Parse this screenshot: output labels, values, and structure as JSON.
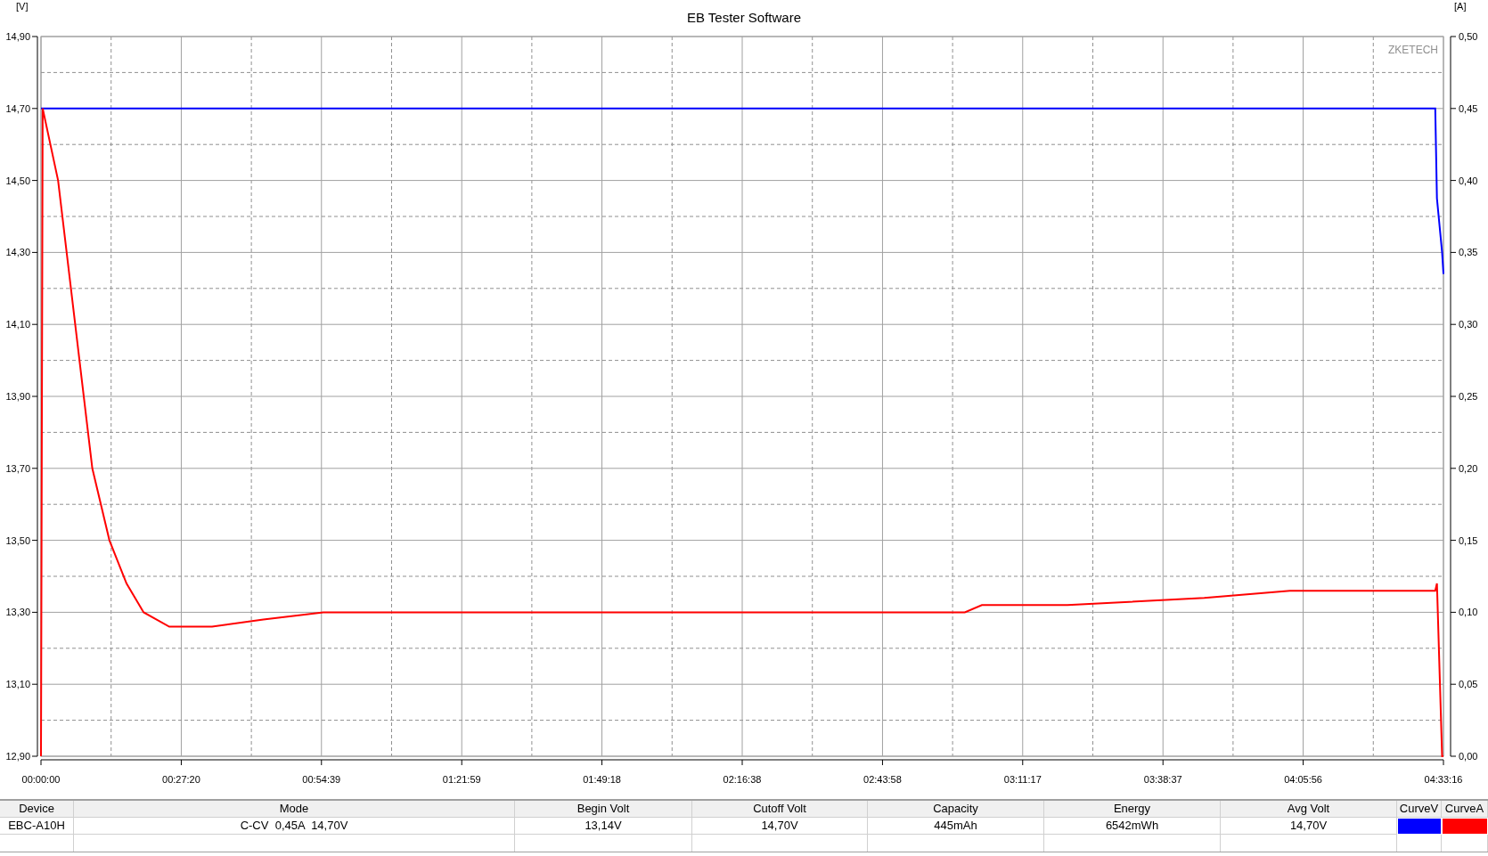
{
  "chart": {
    "brand_label": "ZKETECH",
    "chart_data": {
      "type": "line",
      "title": "EB Tester Software",
      "ylabel": "[V]",
      "grid": true,
      "x": [
        0,
        20,
        200,
        400,
        600,
        800,
        1000,
        1200,
        1500,
        2000,
        2600,
        3300,
        5000,
        8000,
        10800,
        11000,
        12000,
        13600,
        14600,
        16300,
        16320,
        16380,
        16396
      ],
      "series": [
        {
          "name": "CurveV",
          "color": "#0000ff",
          "values": [
            14.7,
            14.7,
            14.7,
            14.7,
            14.7,
            14.7,
            14.7,
            14.7,
            14.7,
            14.7,
            14.7,
            14.7,
            14.7,
            14.7,
            14.7,
            14.7,
            14.7,
            14.7,
            14.7,
            14.7,
            14.45,
            14.3,
            14.24
          ]
        }
      ],
      "xlim": [
        0,
        16396
      ],
      "ylim": [
        12.9,
        14.9
      ],
      "xticks": [
        {
          "value": 0,
          "label": "00:00:00"
        },
        {
          "value": 1640,
          "label": "00:27:20"
        },
        {
          "value": 3279,
          "label": "00:54:39"
        },
        {
          "value": 4919,
          "label": "01:21:59"
        },
        {
          "value": 6558,
          "label": "01:49:18"
        },
        {
          "value": 8198,
          "label": "02:16:38"
        },
        {
          "value": 9838,
          "label": "02:43:58"
        },
        {
          "value": 11477,
          "label": "03:11:17"
        },
        {
          "value": 13117,
          "label": "03:38:37"
        },
        {
          "value": 14756,
          "label": "04:05:56"
        },
        {
          "value": 16396,
          "label": "04:33:16"
        }
      ],
      "yticks": [
        {
          "value": 12.9,
          "label": "12,90"
        },
        {
          "value": 13.1,
          "label": "13,10"
        },
        {
          "value": 13.3,
          "label": "13,30"
        },
        {
          "value": 13.5,
          "label": "13,50"
        },
        {
          "value": 13.7,
          "label": "13,70"
        },
        {
          "value": 13.9,
          "label": "13,90"
        },
        {
          "value": 14.1,
          "label": "14,10"
        },
        {
          "value": 14.3,
          "label": "14,30"
        },
        {
          "value": 14.5,
          "label": "14,50"
        },
        {
          "value": 14.7,
          "label": "14,70"
        },
        {
          "value": 14.9,
          "label": "14,90"
        }
      ]
    }
  },
  "current_chart": {
    "chart_data": {
      "type": "line",
      "ylabel": "[A]",
      "x": [
        0,
        20,
        200,
        400,
        600,
        800,
        1000,
        1200,
        1500,
        2000,
        2600,
        3300,
        5000,
        8000,
        10800,
        11000,
        12000,
        13600,
        14600,
        16300,
        16320,
        16380,
        16396
      ],
      "series": [
        {
          "name": "CurveA",
          "color": "#ff0000",
          "values": [
            0,
            0.45,
            0.4,
            0.3,
            0.2,
            0.15,
            0.12,
            0.1,
            0.09,
            0.09,
            0.095,
            0.1,
            0.1,
            0.1,
            0.1,
            0.105,
            0.105,
            0.11,
            0.115,
            0.115,
            0.12,
            0,
            0
          ]
        }
      ],
      "xlim": [
        0,
        16396
      ],
      "ylim": [
        0,
        0.5
      ],
      "yticks": [
        {
          "value": 0,
          "label": "0,00"
        },
        {
          "value": 0.05,
          "label": "0,05"
        },
        {
          "value": 0.1,
          "label": "0,10"
        },
        {
          "value": 0.15,
          "label": "0,15"
        },
        {
          "value": 0.2,
          "label": "0,20"
        },
        {
          "value": 0.25,
          "label": "0,25"
        },
        {
          "value": 0.3,
          "label": "0,30"
        },
        {
          "value": 0.35,
          "label": "0,35"
        },
        {
          "value": 0.4,
          "label": "0,40"
        },
        {
          "value": 0.45,
          "label": "0,45"
        },
        {
          "value": 0.5,
          "label": "0,50"
        }
      ]
    }
  },
  "table": {
    "columns": [
      "Device",
      "Mode",
      "Begin Volt",
      "Cutoff Volt",
      "Capacity",
      "Energy",
      "Avg Volt"
    ],
    "rows": [
      {
        "cells": [
          "EBC-A10H",
          "C-CV  0,45A  14,70V",
          "13,14V",
          "14,70V",
          "445mAh",
          "6542mWh",
          "14,70V"
        ]
      }
    ]
  }
}
